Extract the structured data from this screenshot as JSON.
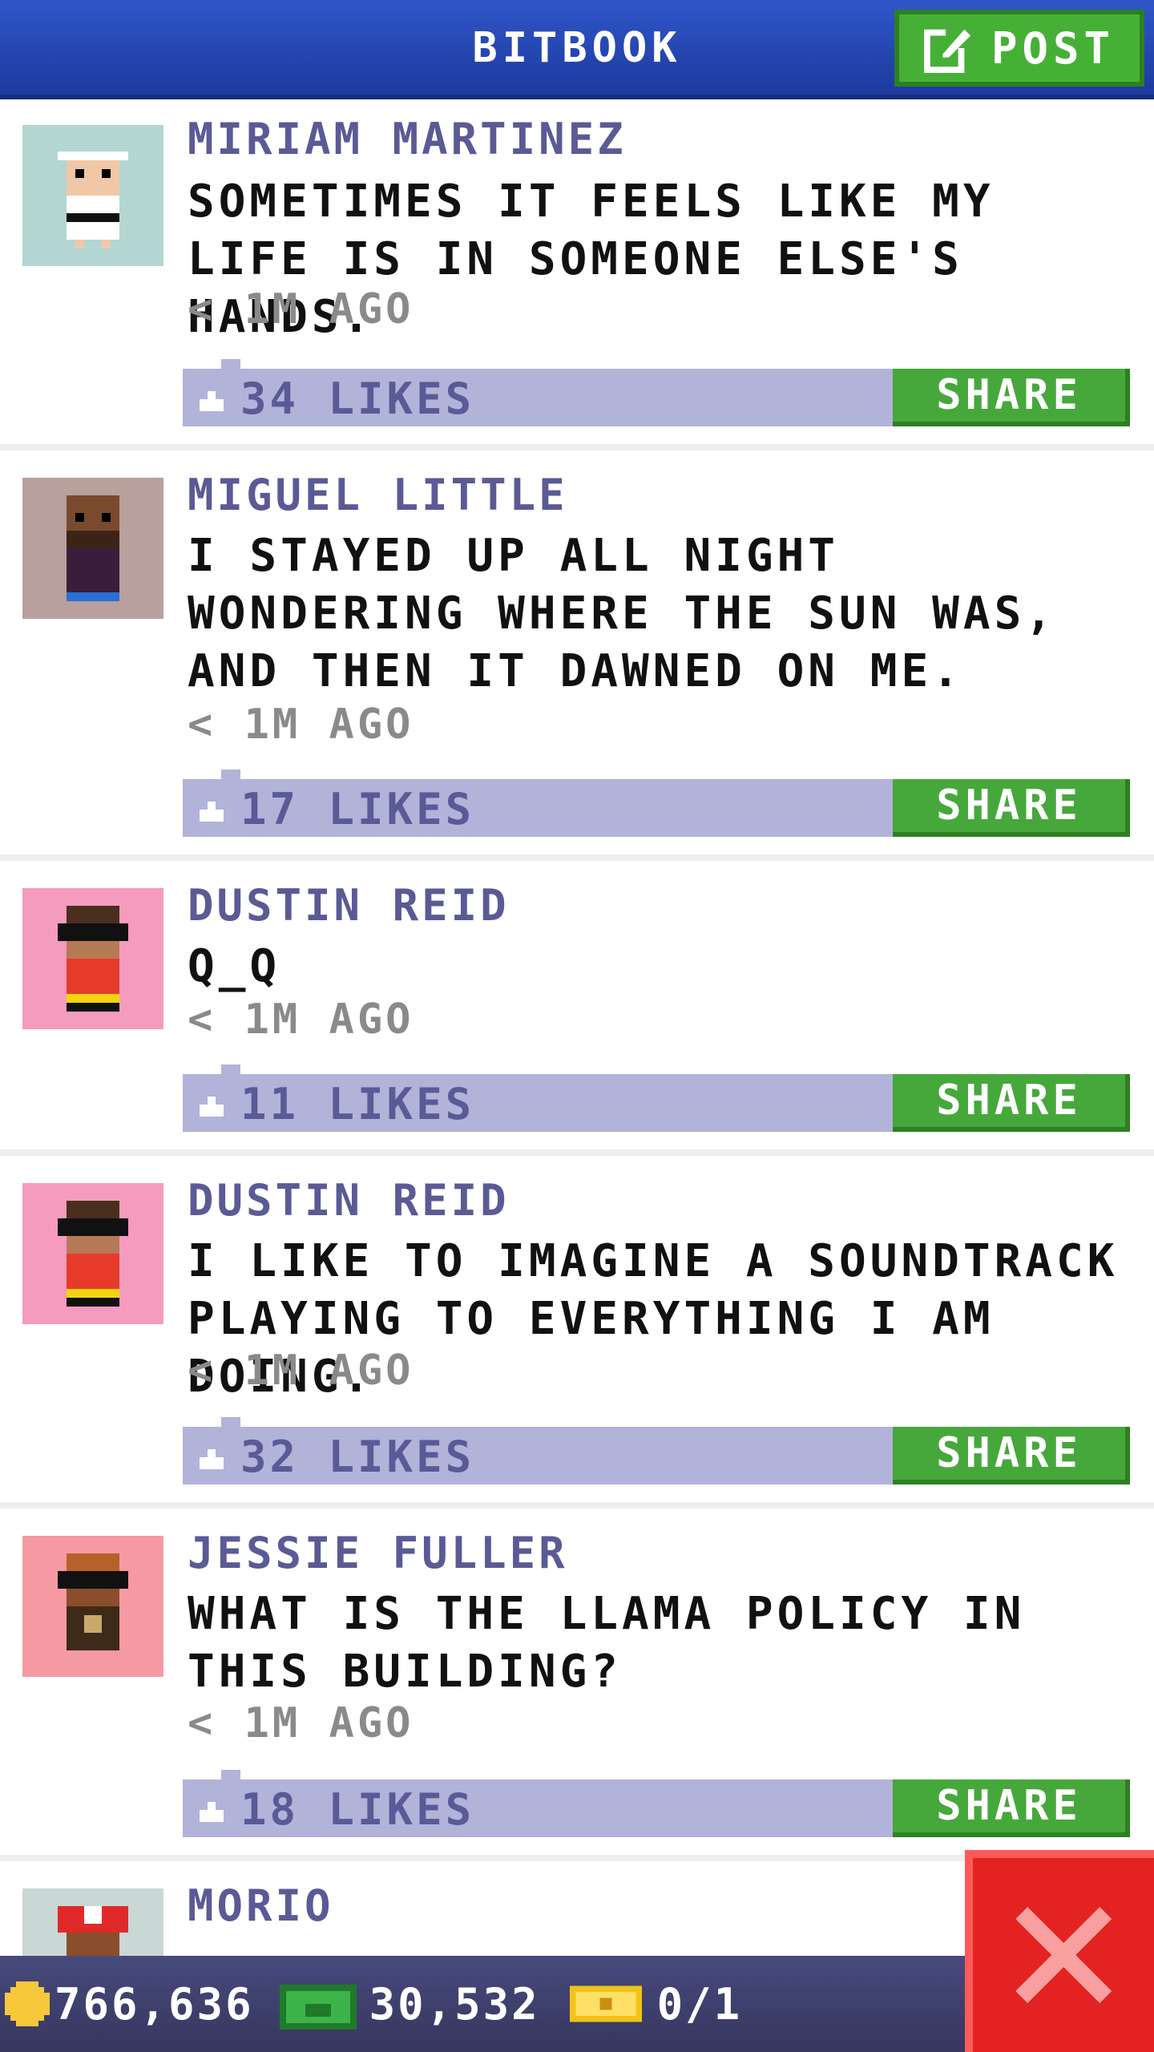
{
  "header": {
    "title": "BITBOOK",
    "post_label": "POST"
  },
  "posts": [
    {
      "author": "MIRIAM MARTINEZ",
      "text": "SOMETIMES IT FEELS LIKE MY LIFE IS IN SOMEONE ELSE'S HANDS.",
      "time": "< 1M AGO",
      "likes": "34 LIKES",
      "share_label": "SHARE",
      "avatar_color": "#b3d6d3"
    },
    {
      "author": "MIGUEL LITTLE",
      "text": "I STAYED UP ALL NIGHT WONDERING WHERE THE SUN WAS, AND THEN IT DAWNED ON ME.",
      "time": "< 1M AGO",
      "likes": "17 LIKES",
      "share_label": "SHARE",
      "avatar_color": "#b8a09d"
    },
    {
      "author": "DUSTIN REID",
      "text": "Q_Q",
      "time": "< 1M AGO",
      "likes": "11 LIKES",
      "share_label": "SHARE",
      "avatar_color": "#f59bbd"
    },
    {
      "author": "DUSTIN REID",
      "text": "I LIKE TO IMAGINE A SOUNDTRACK PLAYING TO EVERYTHING I AM DOING.",
      "time": "< 1M AGO",
      "likes": "32 LIKES",
      "share_label": "SHARE",
      "avatar_color": "#f59bbd"
    },
    {
      "author": "JESSIE FULLER",
      "text": "WHAT IS THE LLAMA POLICY IN THIS BUILDING?",
      "time": "< 1M AGO",
      "likes": "18 LIKES",
      "share_label": "SHARE",
      "avatar_color": "#f59aa2"
    },
    {
      "author": "MORIO",
      "avatar_color": "#c9d7d5"
    }
  ],
  "footer": {
    "coins": "766,636",
    "bux": "30,532",
    "tickets": "0/1"
  },
  "colors": {
    "header_blue": "#2249b4",
    "accent_green": "#46a83a",
    "likes_bar": "#b1b3d9",
    "author_purple": "#5a5a96",
    "close_red": "#e42222"
  },
  "icons": [
    "edit-icon",
    "thumbs-up-icon",
    "coin-icon",
    "cash-icon",
    "ticket-icon",
    "close-icon"
  ]
}
